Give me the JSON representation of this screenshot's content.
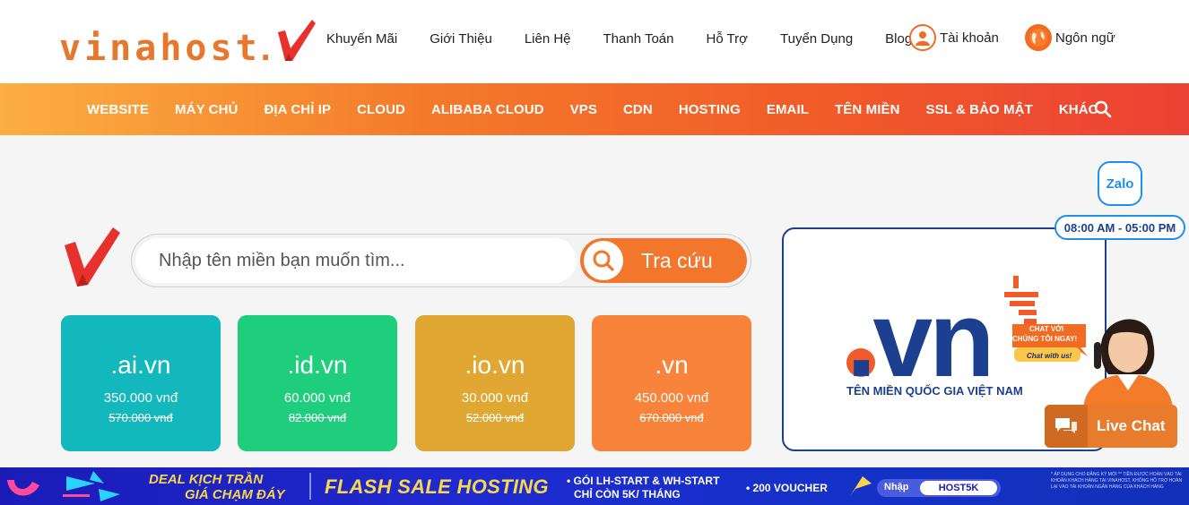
{
  "brand": {
    "logo_text": "vinahost",
    "logo_dot": ".",
    "colors": {
      "orange": "#f3762d",
      "navy": "#1c3f8f",
      "zalo_blue": "#1e8ff0"
    }
  },
  "top_nav": {
    "items": [
      "Khuyến Mãi",
      "Giới Thiệu",
      "Liên Hệ",
      "Thanh Toán",
      "Hỗ Trợ",
      "Tuyển Dụng",
      "Blog"
    ],
    "account_label": "Tài khoản",
    "account_icon": "user-icon",
    "language_label": "Ngôn ngữ",
    "language_icon": "globe-icon"
  },
  "main_nav": {
    "items": [
      "WEBSITE",
      "MÁY CHỦ",
      "ĐỊA CHỈ IP",
      "CLOUD",
      "ALIBABA CLOUD",
      "VPS",
      "CDN",
      "HOSTING",
      "EMAIL",
      "TÊN MIỀN",
      "SSL & BẢO MẬT",
      "KHÁC"
    ],
    "search_icon": "search-icon"
  },
  "domain_search": {
    "placeholder": "Nhập tên miền bạn muốn tìm...",
    "button_label": "Tra cứu"
  },
  "domain_cards": [
    {
      "ext": ".ai.vn",
      "price": "350.000 vnđ",
      "old_price": "570.000 vnđ",
      "color": "#12b8bc"
    },
    {
      "ext": ".id.vn",
      "price": "60.000 vnđ",
      "old_price": "82.000 vnđ",
      "color": "#1fce7c"
    },
    {
      "ext": ".io.vn",
      "price": "30.000 vnđ",
      "old_price": "52.000 vnđ",
      "color": "#e0a733"
    },
    {
      "ext": ".vn",
      "price": "450.000 vnđ",
      "old_price": "670.000 vnđ",
      "color": "#f7843a"
    }
  ],
  "vn_banner": {
    "big_text": ".vn",
    "tagline": "TÊN MIỀN QUỐC GIA VIỆT NAM"
  },
  "support": {
    "zalo_label": "Zalo",
    "hours": "08:00 AM - 05:00 PM",
    "chat_bubble_line1": "CHAT VỚI",
    "chat_bubble_line2": "CHÚNG TÔI NGAY!",
    "chat_bubble_line3": "Chat with us!",
    "live_chat_label": "Live Chat"
  },
  "promo": {
    "deal_line1": "DEAL KỊCH TRẦN",
    "deal_line2": "GIÁ CHẠM ĐÁY",
    "flash": "FLASH SALE HOSTING",
    "offer_line1": "• GÓI LH-START & WH-START",
    "offer_line2": "CHỈ CÒN 5K/ THÁNG",
    "voucher": "• 200 VOUCHER",
    "enter_label": "Nhập",
    "code": "HOST5K",
    "fine_print": "* ÁP DỤNG CHO ĐĂNG KÝ MỚI ** TIỀN ĐƯỢC HOÀN VÀO TÀI KHOẢN KHÁCH HÀNG TẠI VINAHOST, KHÔNG HỖ TRỢ HOÀN LẠI VÀO TÀI KHOẢN NGÂN HÀNG CỦA KHÁCH HÀNG"
  }
}
